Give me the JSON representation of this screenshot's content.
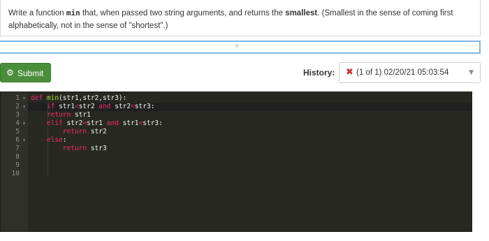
{
  "prompt": {
    "part1": "Write a function ",
    "code": "min",
    "part2": " that, when passed two string arguments, and returns the ",
    "bold": "smallest",
    "part3": ". (Smallest in the sense of coming first alphabetically, not in the sense of \"shortest\".)"
  },
  "expand": {
    "icon": "chevron-double-down-icon",
    "glyph": "»"
  },
  "submit": {
    "label": "Submit",
    "icon": "gear-icon",
    "color": "#4a8e3a"
  },
  "history": {
    "label": "History:",
    "status_icon": "x-icon",
    "status_color": "#c9302c",
    "selected": "(1 of 1) 02/20/21 05:03:54"
  },
  "editor": {
    "theme_bg": "#272822",
    "line_numbers": [
      "1",
      "2",
      "3",
      "4",
      "5",
      "6",
      "7",
      "8",
      "9",
      "10"
    ],
    "fold_markers": [
      "1",
      "2",
      "4",
      "6"
    ],
    "active_line": "2",
    "lines": [
      [
        {
          "t": "kw",
          "v": "def "
        },
        {
          "t": "fn",
          "v": "min"
        },
        {
          "t": "",
          "v": "(str1,str2,str3):"
        }
      ],
      [
        {
          "t": "",
          "v": "    "
        },
        {
          "t": "kw",
          "v": "if"
        },
        {
          "t": "",
          "v": " str1"
        },
        {
          "t": "kw",
          "v": "<"
        },
        {
          "t": "",
          "v": "str2 "
        },
        {
          "t": "kw",
          "v": "and"
        },
        {
          "t": "",
          "v": " str2"
        },
        {
          "t": "kw",
          "v": "<"
        },
        {
          "t": "",
          "v": "str3:"
        }
      ],
      [
        {
          "t": "",
          "v": "    "
        },
        {
          "t": "kw",
          "v": "return"
        },
        {
          "t": "",
          "v": " str1"
        }
      ],
      [
        {
          "t": "",
          "v": "    "
        },
        {
          "t": "kw",
          "v": "elif"
        },
        {
          "t": "",
          "v": " str2"
        },
        {
          "t": "kw",
          "v": "<"
        },
        {
          "t": "",
          "v": "str1 "
        },
        {
          "t": "kw",
          "v": "and"
        },
        {
          "t": "",
          "v": " str1"
        },
        {
          "t": "kw",
          "v": "<"
        },
        {
          "t": "",
          "v": "str3:"
        }
      ],
      [
        {
          "t": "",
          "v": "        "
        },
        {
          "t": "kw",
          "v": "return"
        },
        {
          "t": "",
          "v": " str2"
        }
      ],
      [
        {
          "t": "",
          "v": "    "
        },
        {
          "t": "kw",
          "v": "else"
        },
        {
          "t": "",
          "v": ":"
        }
      ],
      [
        {
          "t": "",
          "v": "        "
        },
        {
          "t": "kw",
          "v": "return"
        },
        {
          "t": "",
          "v": " str3"
        }
      ],
      [],
      [],
      []
    ]
  }
}
